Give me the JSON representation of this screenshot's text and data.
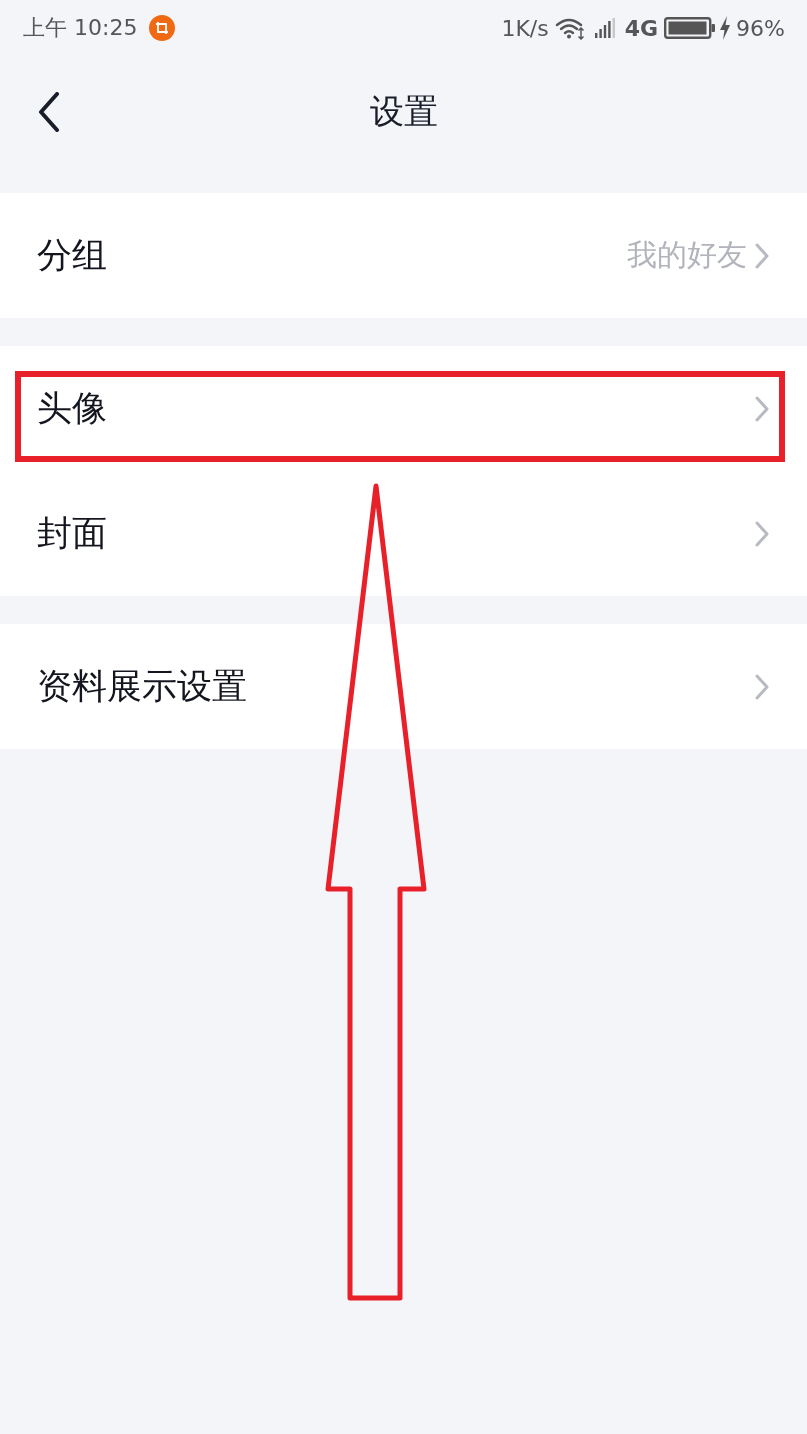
{
  "status_bar": {
    "time": "上午 10:25",
    "network_speed": "1K/s",
    "network_type": "4G",
    "battery_percent": "96%"
  },
  "nav_bar": {
    "title": "设置"
  },
  "groups": [
    {
      "items": [
        {
          "label": "分组",
          "value": "我的好友",
          "highlighted": false
        }
      ]
    },
    {
      "items": [
        {
          "label": "头像",
          "highlighted": true
        },
        {
          "label": "封面",
          "highlighted": false
        }
      ]
    },
    {
      "items": [
        {
          "label": "资料展示设置",
          "highlighted": false
        }
      ]
    }
  ]
}
